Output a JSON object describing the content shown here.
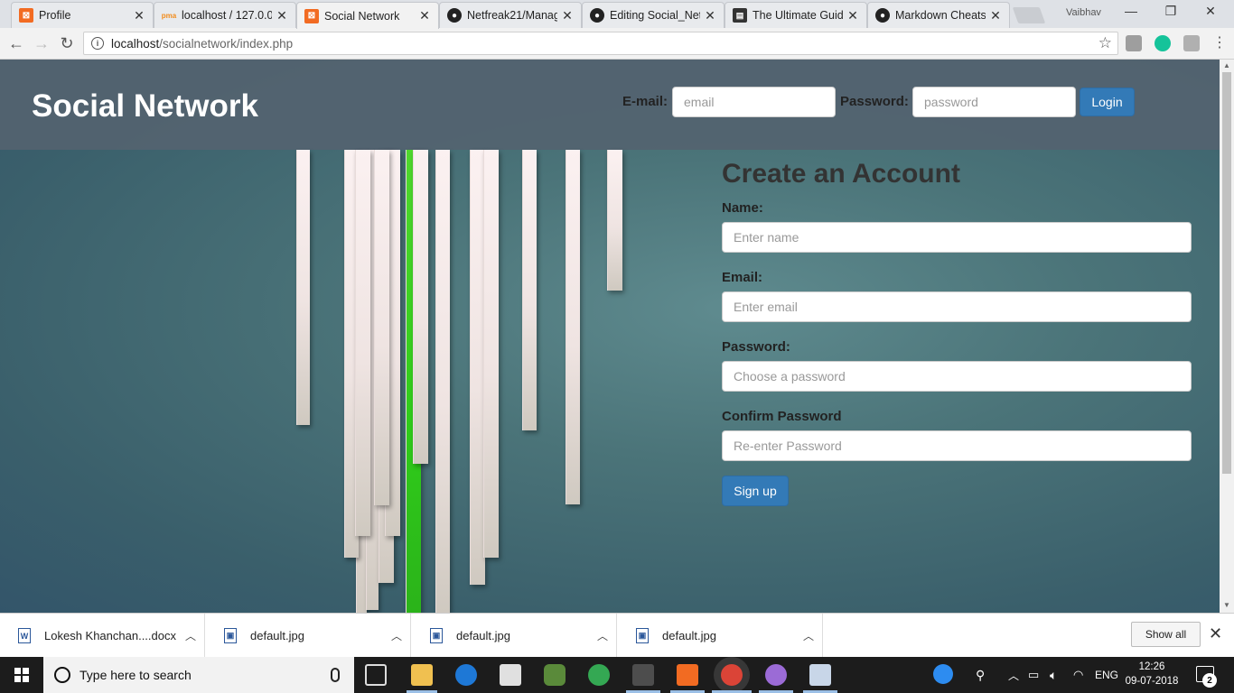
{
  "browser": {
    "tabs": [
      {
        "title": "Profile",
        "icon": "xampp-icon"
      },
      {
        "title": "localhost / 127.0.0",
        "icon": "phpmyadmin-icon"
      },
      {
        "title": "Social Network",
        "icon": "xampp-icon",
        "active": true
      },
      {
        "title": "Netfreak21/Manag",
        "icon": "github-icon"
      },
      {
        "title": "Editing Social_Net",
        "icon": "github-icon"
      },
      {
        "title": "The Ultimate Guide",
        "icon": "guide-icon"
      },
      {
        "title": "Markdown Cheats",
        "icon": "github-icon"
      }
    ],
    "profile_name": "Vaibhav",
    "url_host": "localhost",
    "url_path": "/socialnetwork/index.php"
  },
  "site": {
    "brand": "Social Network",
    "login": {
      "email_label": "E-mail:",
      "email_placeholder": "email",
      "password_label": "Password:",
      "password_placeholder": "password",
      "button": "Login"
    },
    "signup": {
      "title": "Create an Account",
      "fields": [
        {
          "label": "Name:",
          "placeholder": "Enter name"
        },
        {
          "label": "Email:",
          "placeholder": "Enter email"
        },
        {
          "label": "Password:",
          "placeholder": "Choose a password"
        },
        {
          "label": "Confirm Password",
          "placeholder": "Re-enter Password"
        }
      ],
      "button": "Sign up"
    },
    "accent_color": "#337ab7"
  },
  "downloads": {
    "items": [
      {
        "name": "Lokesh Khanchan....docx",
        "type": "word-doc-icon"
      },
      {
        "name": "default.jpg",
        "type": "image-file-icon"
      },
      {
        "name": "default.jpg",
        "type": "image-file-icon"
      },
      {
        "name": "default.jpg",
        "type": "image-file-icon"
      }
    ],
    "show_all": "Show all"
  },
  "taskbar": {
    "search_placeholder": "Type here to search",
    "language": "ENG",
    "time": "12:26",
    "date": "09-07-2018",
    "notification_count": "2"
  }
}
